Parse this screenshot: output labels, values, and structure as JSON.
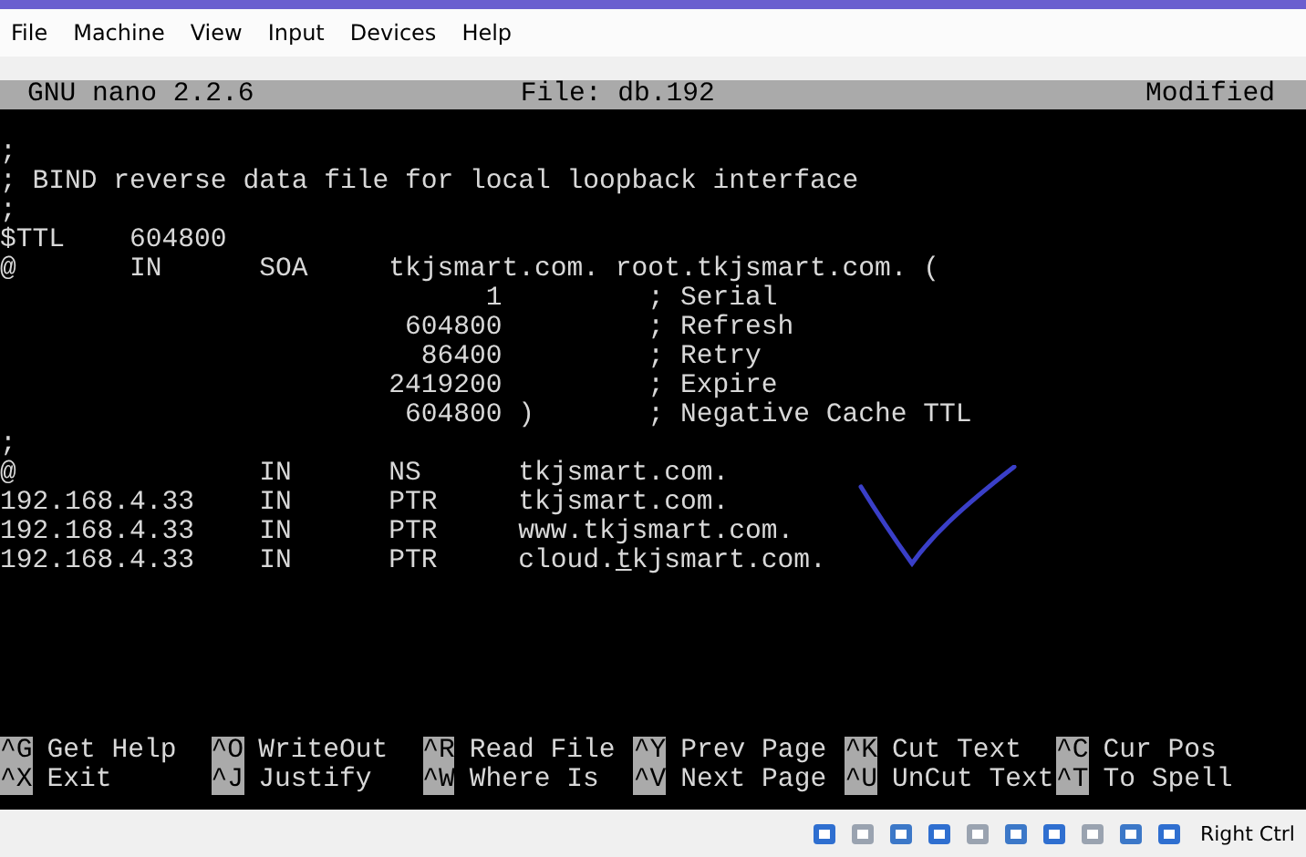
{
  "menu_bar": [
    "File",
    "Machine",
    "View",
    "Input",
    "Devices",
    "Help"
  ],
  "nano_title": {
    "version": "GNU nano 2.2.6",
    "file": "File: db.192",
    "status": "Modified"
  },
  "lines": [
    {
      "text": ";"
    },
    {
      "text": "; BIND reverse data file for local loopback interface"
    },
    {
      "text": ";"
    },
    {
      "text": "$TTL    604800"
    },
    {
      "text": "@       IN      SOA     tkjsmart.com. root.tkjsmart.com. ("
    },
    {
      "text": "                              1         ; Serial"
    },
    {
      "text": "                         604800         ; Refresh"
    },
    {
      "text": "                          86400         ; Retry"
    },
    {
      "text": "                        2419200         ; Expire"
    },
    {
      "text": "                         604800 )       ; Negative Cache TTL"
    },
    {
      "text": ";"
    },
    {
      "text": "@               IN      NS      tkjsmart.com."
    },
    {
      "text": "192.168.4.33    IN      PTR     tkjsmart.com."
    },
    {
      "text": "192.168.4.33    IN      PTR     www.tkjsmart.com."
    },
    {
      "segments": [
        {
          "text": "192.168.4.33    IN      PTR     cloud.",
          "cursor": false
        },
        {
          "text": "t",
          "cursor": true
        },
        {
          "text": "kjsmart.com.",
          "cursor": false
        }
      ]
    }
  ],
  "shortcuts": [
    [
      {
        "key": "^G",
        "label": "Get Help"
      },
      {
        "key": "^O",
        "label": "WriteOut"
      },
      {
        "key": "^R",
        "label": "Read File"
      },
      {
        "key": "^Y",
        "label": "Prev Page"
      },
      {
        "key": "^K",
        "label": "Cut Text"
      },
      {
        "key": "^C",
        "label": "Cur Pos"
      }
    ],
    [
      {
        "key": "^X",
        "label": "Exit"
      },
      {
        "key": "^J",
        "label": "Justify"
      },
      {
        "key": "^W",
        "label": "Where Is"
      },
      {
        "key": "^V",
        "label": "Next Page"
      },
      {
        "key": "^U",
        "label": "UnCut Text"
      },
      {
        "key": "^T",
        "label": "To Spell"
      }
    ]
  ],
  "status_bar": {
    "host_key": "Right Ctrl"
  }
}
